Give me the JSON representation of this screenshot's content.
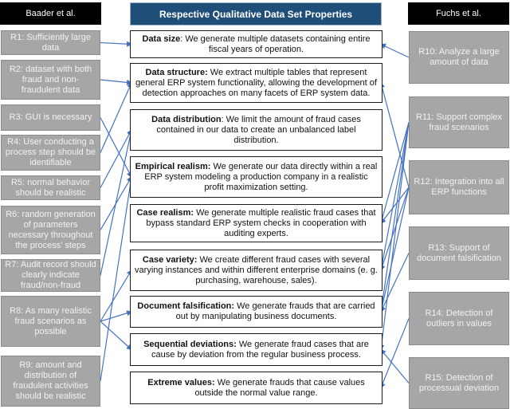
{
  "headers": {
    "left": "Baader et al.",
    "center": "Respective Qualitative Data Set Properties",
    "right": "Fuchs et al."
  },
  "left_requirements": [
    {
      "id": "R1",
      "text": "R1: Sufficiently large data"
    },
    {
      "id": "R2",
      "text": "R2: dataset with both fraud and non-fraudulent data"
    },
    {
      "id": "R3",
      "text": "R3: GUI is necessary"
    },
    {
      "id": "R4",
      "text": "R4: User conducting a process step should be identifiable"
    },
    {
      "id": "R5",
      "text": "R5: normal behavior should be realistic"
    },
    {
      "id": "R6",
      "text": "R6: random generation of parameters necessary throughout the process' steps"
    },
    {
      "id": "R7",
      "text": "R7: Audit record should clearly indicate fraud/non-fraud"
    },
    {
      "id": "R8",
      "text": "R8: As many realistic fraud scenarios as possible"
    },
    {
      "id": "R9",
      "text": "R9: amount and distribution of fraudulent activities should be realistic"
    }
  ],
  "properties": [
    {
      "id": "size",
      "title": "Data size",
      "text": ": We generate multiple datasets containing entire fiscal years of operation."
    },
    {
      "id": "structure",
      "title": "Data structure:",
      "text": " We extract multiple tables that represent general ERP system functionality, allowing the development of detection approaches on many facets of ERP system data."
    },
    {
      "id": "distribution",
      "title": "Data distribution",
      "text": ": We limit the amount of fraud cases contained in our data to create an unbalanced label distribution."
    },
    {
      "id": "empirical",
      "title": "Empirical realism:",
      "text": " We generate our data directly within a real ERP system modeling a production company in a realistic profit maximization setting."
    },
    {
      "id": "case_realism",
      "title": "Case realism:",
      "text": " We generate multiple realistic fraud cases that bypass standard ERP system checks in cooperation with auditing experts."
    },
    {
      "id": "variety",
      "title": "Case variety:",
      "text": " We create different fraud cases with several varying instances and within different enterprise domains (e. g. purchasing, warehouse, sales)."
    },
    {
      "id": "doc",
      "title": "Document falsification:",
      "text": " We generate frauds that are carried out by manipulating business documents."
    },
    {
      "id": "sequential",
      "title": "Sequential deviations:",
      "text": " We generate fraud cases that are cause by deviation from the regular business process."
    },
    {
      "id": "extreme",
      "title": "Extreme values:",
      "text": " We generate frauds that cause values outside the normal value range."
    }
  ],
  "right_requirements": [
    {
      "id": "R10",
      "text": "R10: Analyze a large amount of data"
    },
    {
      "id": "R11",
      "text": "R11: Support complex fraud scenarios"
    },
    {
      "id": "R12",
      "text": "R12: Integration into all ERP functions"
    },
    {
      "id": "R13",
      "text": "R13: Support of document falsification"
    },
    {
      "id": "R14",
      "text": "R14: Detection of outliers in values"
    },
    {
      "id": "R15",
      "text": "R15: Detection of processual deviation"
    }
  ],
  "connections": [
    {
      "from": "R1",
      "to": "size"
    },
    {
      "from": "R2",
      "to": "structure"
    },
    {
      "from": "R3",
      "to": "empirical"
    },
    {
      "from": "R4",
      "to": "structure"
    },
    {
      "from": "R5",
      "to": "distribution"
    },
    {
      "from": "R6",
      "to": "empirical"
    },
    {
      "from": "R7",
      "to": "distribution"
    },
    {
      "from": "R8",
      "to": "variety"
    },
    {
      "from": "R8",
      "to": "doc"
    },
    {
      "from": "R8",
      "to": "sequential"
    },
    {
      "from": "R9",
      "to": "empirical"
    },
    {
      "from": "R10",
      "to": "size"
    },
    {
      "from": "R11",
      "to": "case_realism"
    },
    {
      "from": "R11",
      "to": "variety"
    },
    {
      "from": "R11",
      "to": "doc"
    },
    {
      "from": "R11",
      "to": "sequential"
    },
    {
      "from": "R12",
      "to": "case_realism"
    },
    {
      "from": "R12",
      "to": "variety"
    },
    {
      "from": "R12",
      "to": "doc"
    },
    {
      "from": "R12",
      "to": "structure"
    },
    {
      "from": "R13",
      "to": "doc"
    },
    {
      "from": "R14",
      "to": "extreme"
    },
    {
      "from": "R15",
      "to": "sequential"
    }
  ],
  "colors": {
    "line": "#4472c4",
    "header_blue": "#1f4e79",
    "req_grey": "#a6a6a6"
  }
}
